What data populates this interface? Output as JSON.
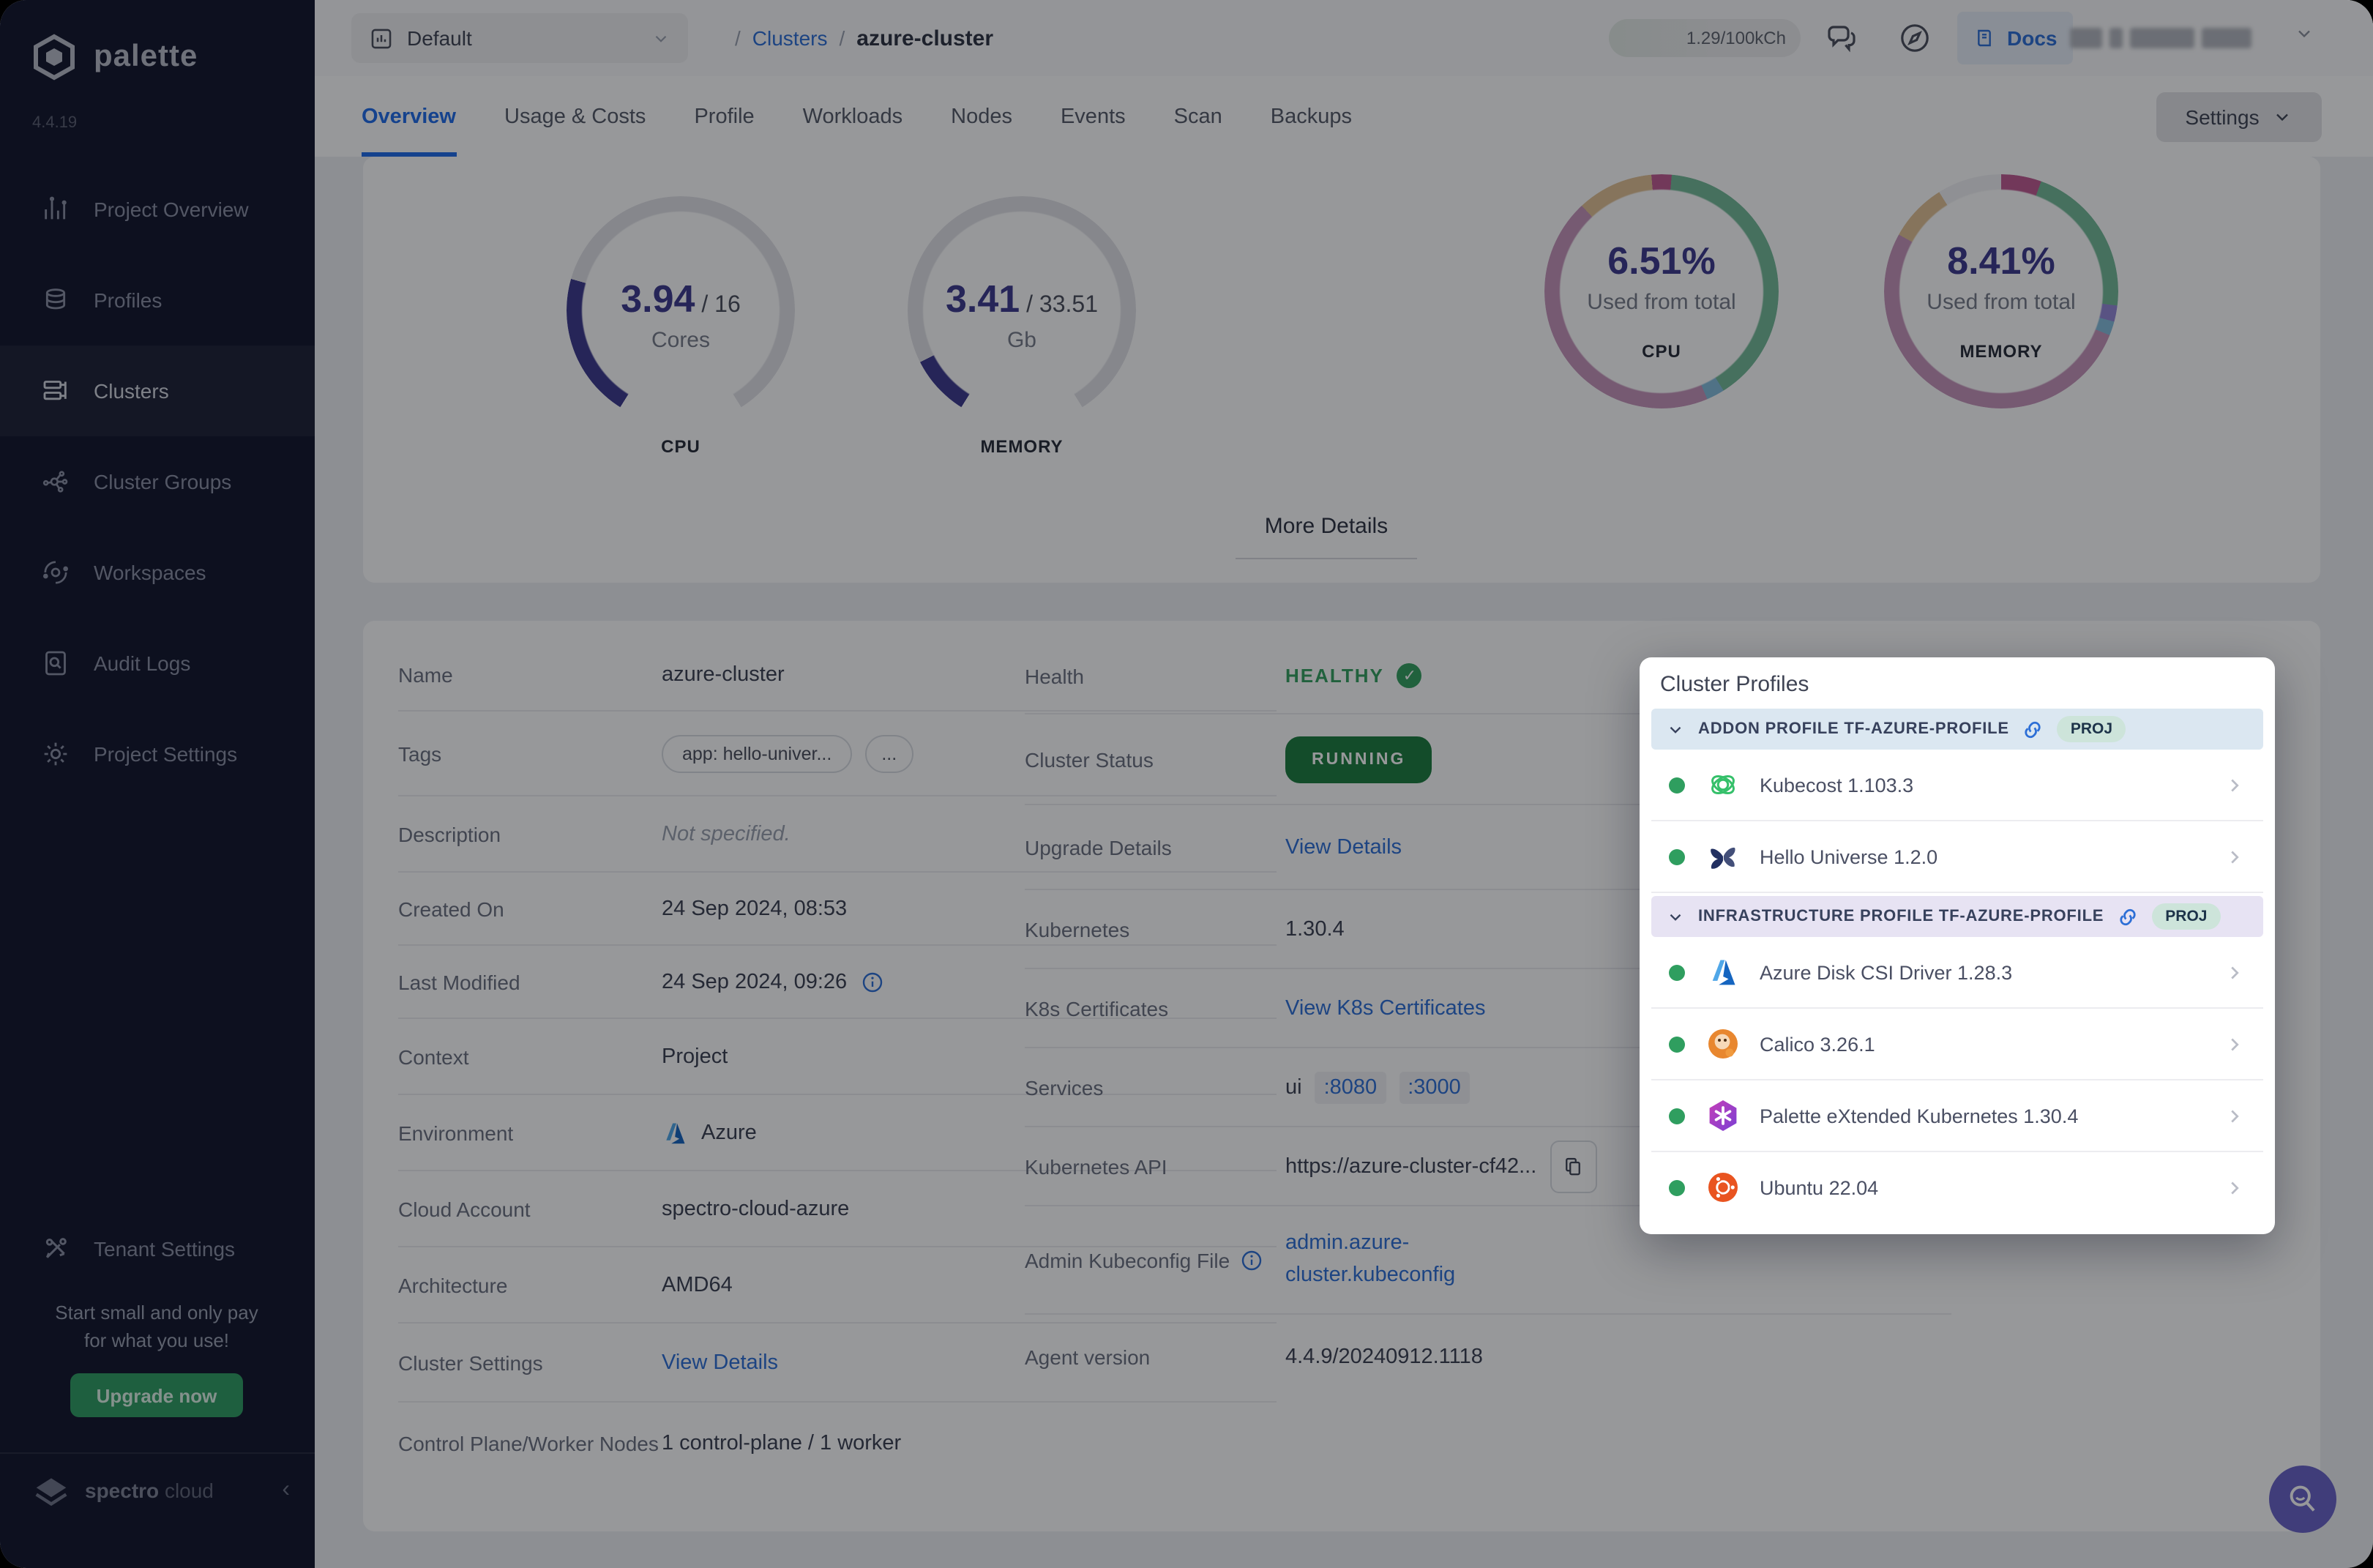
{
  "sidebar": {
    "brand": "palette",
    "version": "4.4.19",
    "items": [
      {
        "label": "Project Overview"
      },
      {
        "label": "Profiles"
      },
      {
        "label": "Clusters"
      },
      {
        "label": "Cluster Groups"
      },
      {
        "label": "Workspaces"
      },
      {
        "label": "Audit Logs"
      },
      {
        "label": "Project Settings"
      }
    ],
    "tenant_settings": "Tenant Settings",
    "promo_line1": "Start small and only pay",
    "promo_line2": "for what you use!",
    "upgrade_button": "Upgrade now",
    "footer_brand_bold": "spectro",
    "footer_brand_light": "cloud"
  },
  "topbar": {
    "project_selector": "Default",
    "breadcrumb_sep1": "/",
    "breadcrumb_link": "Clusters",
    "breadcrumb_sep2": "/",
    "breadcrumb_current": "azure-cluster",
    "usage": "1.29/100kCh",
    "docs_button": "Docs"
  },
  "tabs": {
    "items": [
      {
        "label": "Overview"
      },
      {
        "label": "Usage & Costs"
      },
      {
        "label": "Profile"
      },
      {
        "label": "Workloads"
      },
      {
        "label": "Nodes"
      },
      {
        "label": "Events"
      },
      {
        "label": "Scan"
      },
      {
        "label": "Backups"
      }
    ],
    "settings_button": "Settings"
  },
  "metrics": {
    "cpu_gauge": {
      "used": "3.94",
      "total": "/ 16",
      "unit": "Cores",
      "label": "CPU",
      "used_value": 3.94,
      "total_value": 16
    },
    "memory_gauge": {
      "used": "3.41",
      "total": "/ 33.51",
      "unit": "Gb",
      "label": "MEMORY",
      "used_value": 3.41,
      "total_value": 33.51
    },
    "cpu_donut": {
      "percent": "6.51%",
      "caption": "Used from total",
      "label": "CPU"
    },
    "memory_donut": {
      "percent": "8.41%",
      "caption": "Used from total",
      "label": "MEMORY"
    },
    "more_details": "More Details"
  },
  "details": {
    "name_label": "Name",
    "name_value": "azure-cluster",
    "tags_label": "Tags",
    "tag_chip": "app: hello-univer...",
    "tag_more": "...",
    "description_label": "Description",
    "description_value": "Not specified.",
    "created_label": "Created On",
    "created_value": "24 Sep 2024, 08:53",
    "modified_label": "Last Modified",
    "modified_value": "24 Sep 2024, 09:26",
    "context_label": "Context",
    "context_value": "Project",
    "environment_label": "Environment",
    "environment_value": "Azure",
    "cloud_account_label": "Cloud Account",
    "cloud_account_value": "spectro-cloud-azure",
    "architecture_label": "Architecture",
    "architecture_value": "AMD64",
    "cluster_settings_label": "Cluster Settings",
    "cluster_settings_link": "View Details",
    "nodes_label": "Control Plane/Worker Nodes",
    "nodes_value": "1 control-plane / 1 worker",
    "health_label": "Health",
    "health_value": "HEALTHY",
    "health_check": "✓",
    "status_label": "Cluster Status",
    "status_value": "RUNNING",
    "upgrade_label": "Upgrade Details",
    "upgrade_link": "View Details",
    "kubernetes_label": "Kubernetes",
    "kubernetes_value": "1.30.4",
    "certs_label": "K8s Certificates",
    "certs_link": "View K8s Certificates",
    "services_label": "Services",
    "services_name": "ui",
    "services_port1": ":8080",
    "services_port2": ":3000",
    "api_label": "Kubernetes API",
    "api_value": "https://azure-cluster-cf42...",
    "kubeconfig_label": "Admin Kubeconfig File",
    "kubeconfig_link": "admin.azure-cluster.kubeconfig",
    "agent_label": "Agent version",
    "agent_value": "4.4.9/20240912.1118"
  },
  "profiles": {
    "title": "Cluster Profiles",
    "sections": [
      {
        "header": "ADDON PROFILE TF-AZURE-PROFILE",
        "badge": "PROJ",
        "items": [
          {
            "name": "Kubecost 1.103.3"
          },
          {
            "name": "Hello Universe 1.2.0"
          }
        ]
      },
      {
        "header": "INFRASTRUCTURE PROFILE TF-AZURE-PROFILE",
        "badge": "PROJ",
        "items": [
          {
            "name": "Azure Disk CSI Driver 1.28.3"
          },
          {
            "name": "Calico 3.26.1"
          },
          {
            "name": "Palette eXtended Kubernetes 1.30.4"
          },
          {
            "name": "Ubuntu 22.04"
          }
        ]
      }
    ]
  },
  "colors": {
    "accent_blue": "#1f6ce8",
    "gauge_indigo": "#3d3a8e",
    "healthy_green": "#35a05f",
    "running_green": "#1c7c3f",
    "upgrade_green": "#2f9e62",
    "sidebar_bg": "#12152b"
  }
}
